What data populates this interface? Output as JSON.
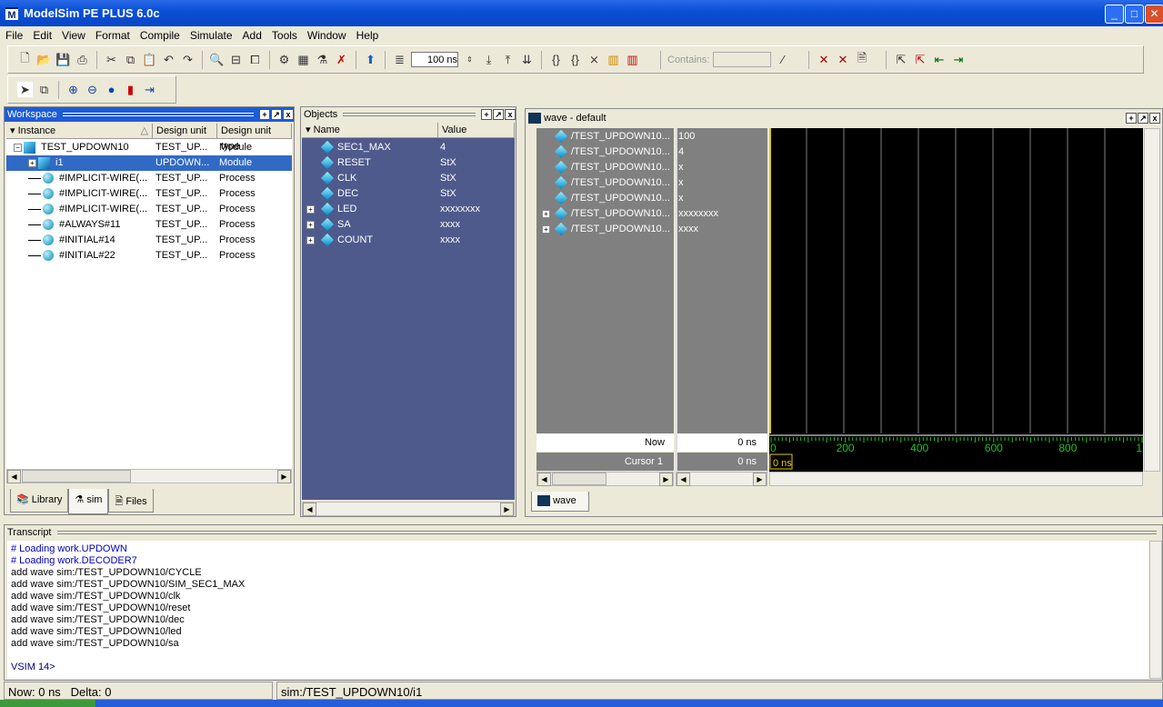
{
  "window": {
    "title": "ModelSim PE PLUS 6.0c",
    "app_icon": "M"
  },
  "menu": [
    "File",
    "Edit",
    "View",
    "Format",
    "Compile",
    "Simulate",
    "Add",
    "Tools",
    "Window",
    "Help"
  ],
  "toolbar": {
    "run_length": "100 ns",
    "contains_label": "Contains:",
    "contains_value": ""
  },
  "workspace": {
    "title": "Workspace",
    "columns": [
      "Instance",
      "Design unit",
      "Design unit type"
    ],
    "rows": [
      {
        "name": "TEST_UPDOWN10",
        "unit": "TEST_UP...",
        "type": "Module",
        "icon": "module",
        "expand": "minus",
        "level": 0
      },
      {
        "name": "i1",
        "unit": "UPDOWN...",
        "type": "Module",
        "icon": "module",
        "expand": "plus",
        "level": 1,
        "selected": true
      },
      {
        "name": "#IMPLICIT-WIRE(...",
        "unit": "TEST_UP...",
        "type": "Process",
        "icon": "process",
        "level": 1
      },
      {
        "name": "#IMPLICIT-WIRE(...",
        "unit": "TEST_UP...",
        "type": "Process",
        "icon": "process",
        "level": 1
      },
      {
        "name": "#IMPLICIT-WIRE(...",
        "unit": "TEST_UP...",
        "type": "Process",
        "icon": "process",
        "level": 1
      },
      {
        "name": "#ALWAYS#11",
        "unit": "TEST_UP...",
        "type": "Process",
        "icon": "process",
        "level": 1
      },
      {
        "name": "#INITIAL#14",
        "unit": "TEST_UP...",
        "type": "Process",
        "icon": "process",
        "level": 1
      },
      {
        "name": "#INITIAL#22",
        "unit": "TEST_UP...",
        "type": "Process",
        "icon": "process",
        "level": 1
      }
    ],
    "tabs": [
      "Library",
      "sim",
      "Files"
    ],
    "active_tab": "sim"
  },
  "objects": {
    "title": "Objects",
    "columns": [
      "Name",
      "Value"
    ],
    "rows": [
      {
        "name": "SEC1_MAX",
        "value": "4"
      },
      {
        "name": "RESET",
        "value": "StX"
      },
      {
        "name": "CLK",
        "value": "StX"
      },
      {
        "name": "DEC",
        "value": "StX"
      },
      {
        "name": "LED",
        "value": "xxxxxxxx",
        "expandable": true
      },
      {
        "name": "SA",
        "value": "xxxx",
        "expandable": true
      },
      {
        "name": "COUNT",
        "value": "xxxx",
        "expandable": true
      }
    ]
  },
  "wave": {
    "title": "wave - default",
    "signals": [
      {
        "name": "/TEST_UPDOWN10...",
        "value": "100"
      },
      {
        "name": "/TEST_UPDOWN10...",
        "value": "4"
      },
      {
        "name": "/TEST_UPDOWN10...",
        "value": "x"
      },
      {
        "name": "/TEST_UPDOWN10...",
        "value": "x"
      },
      {
        "name": "/TEST_UPDOWN10...",
        "value": "x"
      },
      {
        "name": "/TEST_UPDOWN10...",
        "value": "xxxxxxxx",
        "expandable": true
      },
      {
        "name": "/TEST_UPDOWN10...",
        "value": "xxxx",
        "expandable": true
      }
    ],
    "now_label": "Now",
    "now_value": "0 ns",
    "cursor_label": "Cursor 1",
    "cursor_value": "0 ns",
    "cursor_marker": "0 ns",
    "axis_ticks": [
      "0",
      "200",
      "400",
      "600",
      "800",
      "1"
    ],
    "tab": "wave",
    "colors": {
      "background": "#000000",
      "grid": "#808080",
      "axis": "#22c322",
      "cursor": "#e6c800"
    }
  },
  "transcript": {
    "title": "Transcript",
    "lines": [
      {
        "text": "# Loading work.UPDOWN",
        "color": "#0000c0"
      },
      {
        "text": "# Loading work.DECODER7",
        "color": "#0000c0"
      },
      {
        "text": "add wave sim:/TEST_UPDOWN10/CYCLE",
        "color": "#000000"
      },
      {
        "text": "add wave sim:/TEST_UPDOWN10/SIM_SEC1_MAX",
        "color": "#000000"
      },
      {
        "text": "add wave sim:/TEST_UPDOWN10/clk",
        "color": "#000000"
      },
      {
        "text": "add wave sim:/TEST_UPDOWN10/reset",
        "color": "#000000"
      },
      {
        "text": "add wave sim:/TEST_UPDOWN10/dec",
        "color": "#000000"
      },
      {
        "text": "add wave sim:/TEST_UPDOWN10/led",
        "color": "#000000"
      },
      {
        "text": "add wave sim:/TEST_UPDOWN10/sa",
        "color": "#000000"
      }
    ],
    "prompt": "VSIM 14>"
  },
  "status": {
    "now": "Now: 0 ns",
    "delta": "Delta: 0",
    "context": "sim:/TEST_UPDOWN10/i1"
  }
}
